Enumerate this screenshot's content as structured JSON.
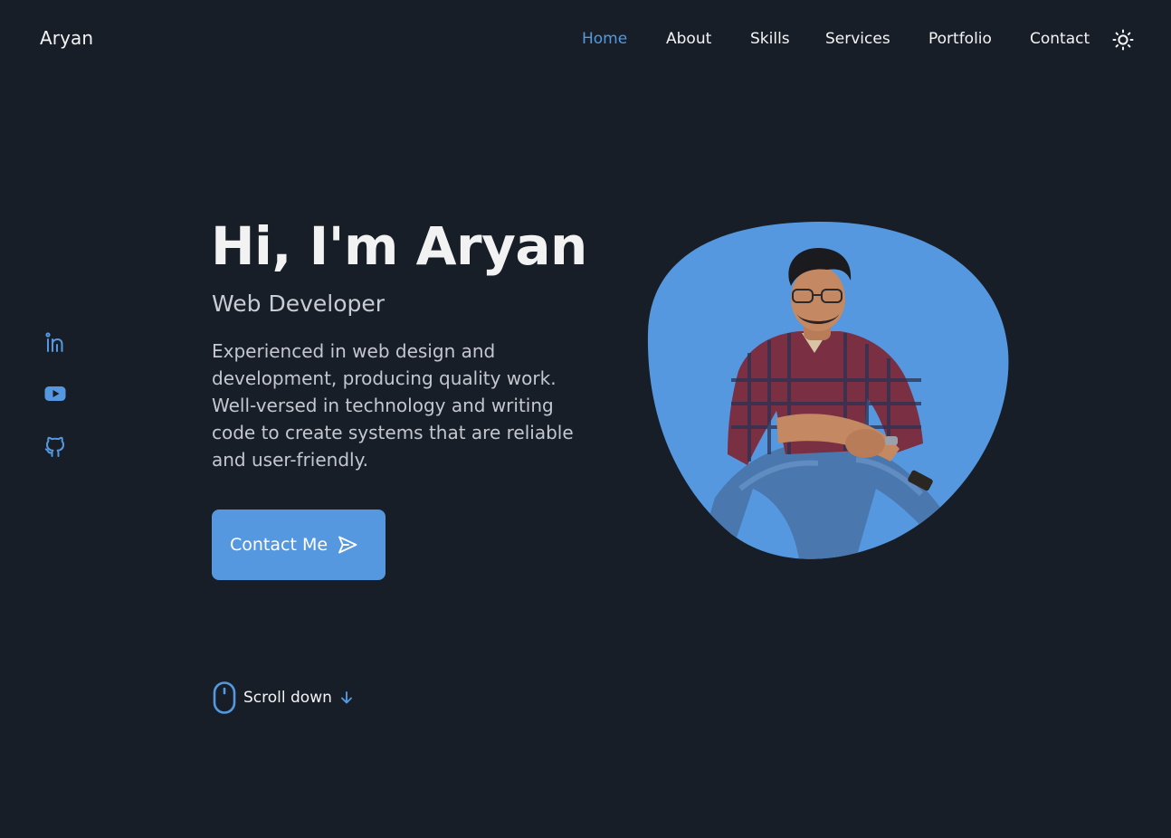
{
  "colors": {
    "accent": "#5598df",
    "background": "#171e28",
    "text": "#f4f4f4",
    "muted_text": "#c4c7cd"
  },
  "header": {
    "logo": "Aryan",
    "nav": [
      {
        "label": "Home",
        "active": true
      },
      {
        "label": "About",
        "active": false
      },
      {
        "label": "Skills",
        "active": false
      },
      {
        "label": "Services",
        "active": false
      },
      {
        "label": "Portfolio",
        "active": false
      },
      {
        "label": "Contact",
        "active": false
      }
    ],
    "theme_icon": "sun-icon"
  },
  "social": [
    {
      "icon": "linkedin-icon"
    },
    {
      "icon": "youtube-icon"
    },
    {
      "icon": "github-icon"
    }
  ],
  "hero": {
    "title": "Hi, I'm Aryan",
    "subtitle": "Web Developer",
    "description": "Experienced in web design and development, producing quality work. Well-versed in technology and writing code to create systems that are reliable and user-friendly.",
    "button": {
      "label": "Contact Me",
      "icon": "send-icon"
    },
    "photo": {
      "icon": "profile-photo"
    }
  },
  "scroll": {
    "label": "Scroll down",
    "icons": [
      "mouse-icon",
      "arrow-down-icon"
    ]
  }
}
